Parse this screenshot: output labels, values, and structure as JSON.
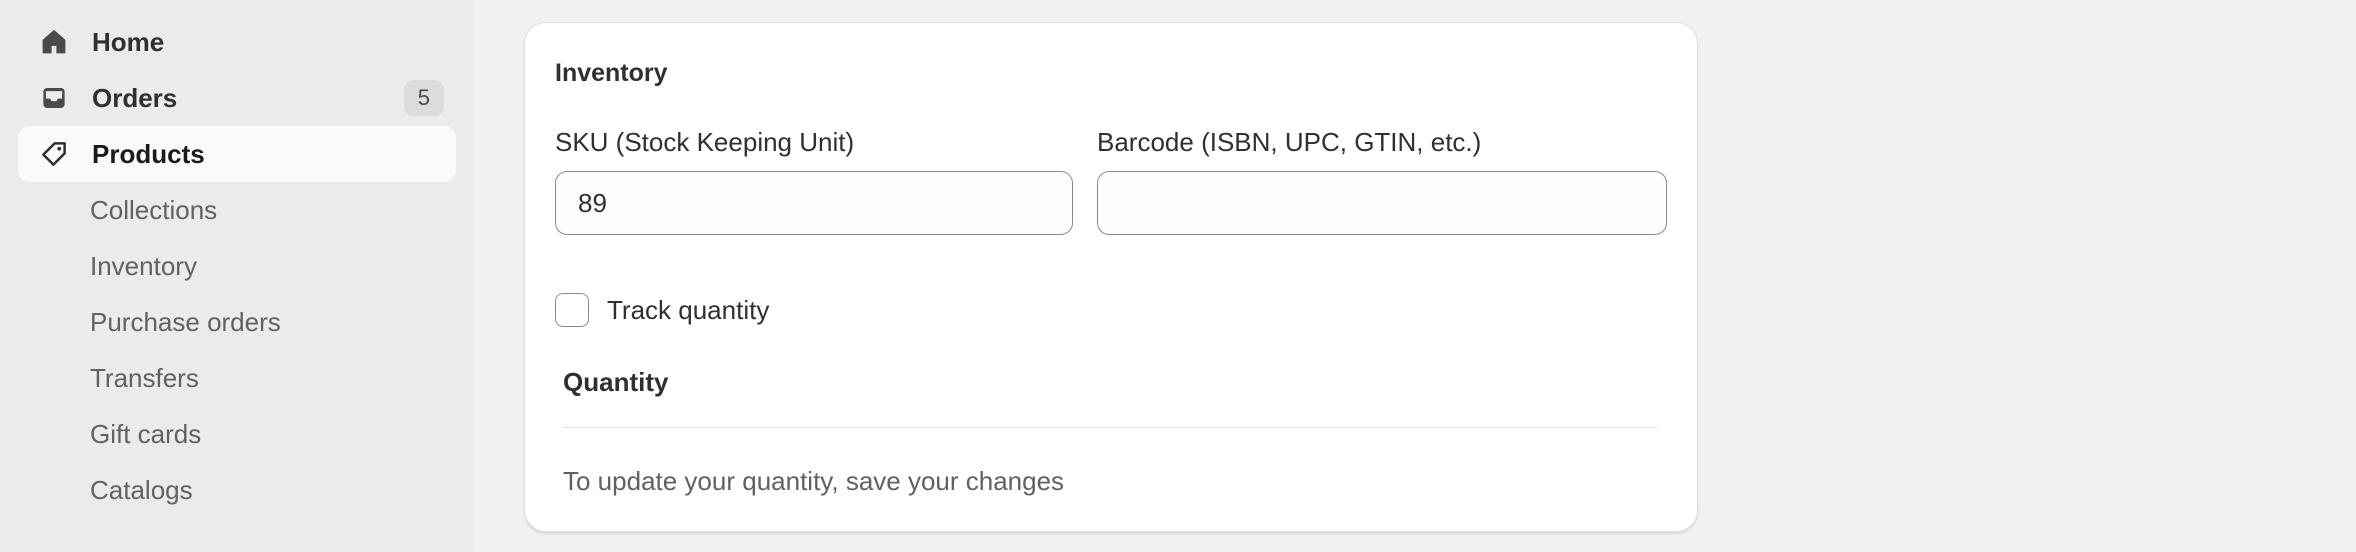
{
  "sidebar": {
    "items": [
      {
        "label": "Home",
        "icon": "home-icon"
      },
      {
        "label": "Orders",
        "icon": "inbox-icon",
        "badge": "5"
      },
      {
        "label": "Products",
        "icon": "tag-icon",
        "active": true
      }
    ],
    "sub_items": [
      {
        "label": "Collections"
      },
      {
        "label": "Inventory"
      },
      {
        "label": "Purchase orders"
      },
      {
        "label": "Transfers"
      },
      {
        "label": "Gift cards"
      },
      {
        "label": "Catalogs"
      }
    ]
  },
  "inventory": {
    "title": "Inventory",
    "sku": {
      "label": "SKU (Stock Keeping Unit)",
      "value": "89"
    },
    "barcode": {
      "label": "Barcode (ISBN, UPC, GTIN, etc.)",
      "value": ""
    },
    "track_quantity": {
      "label": "Track quantity",
      "checked": false
    },
    "quantity_heading": "Quantity",
    "quantity_hint": "To update your quantity, save your changes"
  },
  "colors": {
    "sidebar_bg": "#ebebeb",
    "page_bg": "#f1f1f1",
    "card_bg": "#ffffff",
    "text": "#303030",
    "muted_text": "#616161"
  }
}
